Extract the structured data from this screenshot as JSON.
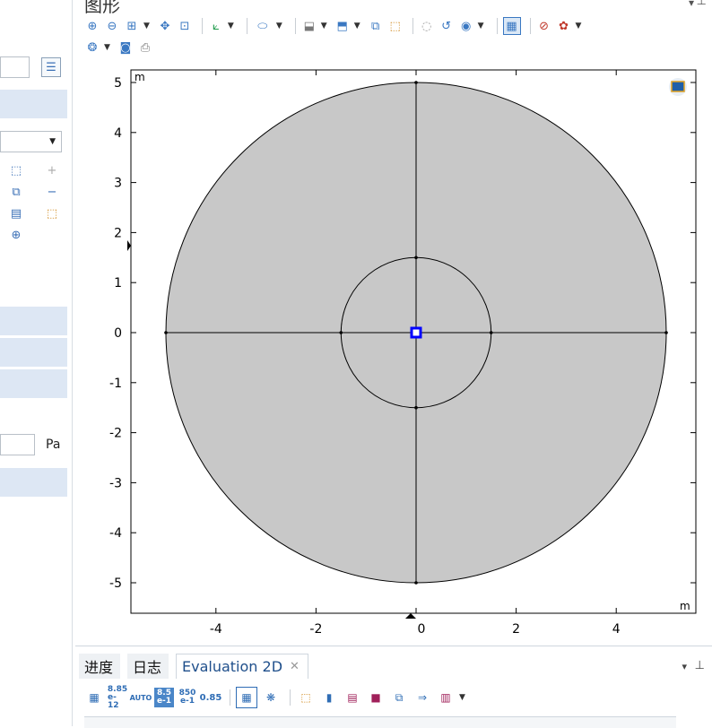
{
  "graphics": {
    "title": "图形",
    "axis_unit_top": "m",
    "axis_unit_bottom": "m"
  },
  "left": {
    "pressure_unit": "Pa"
  },
  "toolbar": {
    "icons": [
      "zoom-in-icon",
      "zoom-out-icon",
      "zoom-box-icon",
      "move-icon",
      "zoom-extents-icon",
      "axis-orientation-icon",
      "select-box-icon",
      "select-domain-icon",
      "print-view-icon",
      "select-all-icon",
      "clear-selection-icon",
      "hide-icon",
      "reset-hiding-icon",
      "view-icon",
      "grid-icon",
      "scene-light-icon",
      "color-icon",
      "lens-icon",
      "camera-icon",
      "printer-icon"
    ]
  },
  "bottom": {
    "tabs": [
      {
        "label": "进度"
      },
      {
        "label": "日志"
      },
      {
        "label": "Evaluation 2D",
        "close": "✕"
      }
    ],
    "format_buttons": [
      {
        "top": "8.85",
        "bottom": "e-12"
      },
      {
        "label": "AUTO"
      },
      {
        "top": "8.5",
        "bottom": "e-1"
      },
      {
        "top": "850",
        "bottom": "e-1"
      },
      {
        "label": "0.85"
      }
    ]
  },
  "chart_data": {
    "type": "geometry",
    "xlim": [
      -5.2,
      5.2
    ],
    "ylim": [
      -5.2,
      5.2
    ],
    "x_ticks": [
      -4,
      -2,
      0,
      2,
      4
    ],
    "y_ticks": [
      5,
      4,
      3,
      2,
      1,
      0,
      -1,
      -2,
      -3,
      -4,
      -5
    ],
    "outer_circle_radius": 5,
    "inner_circle_radius": 1.5,
    "fill_color": "#c8c8c8",
    "selected_point": [
      0,
      0
    ],
    "selection_color": "#0000ff"
  }
}
